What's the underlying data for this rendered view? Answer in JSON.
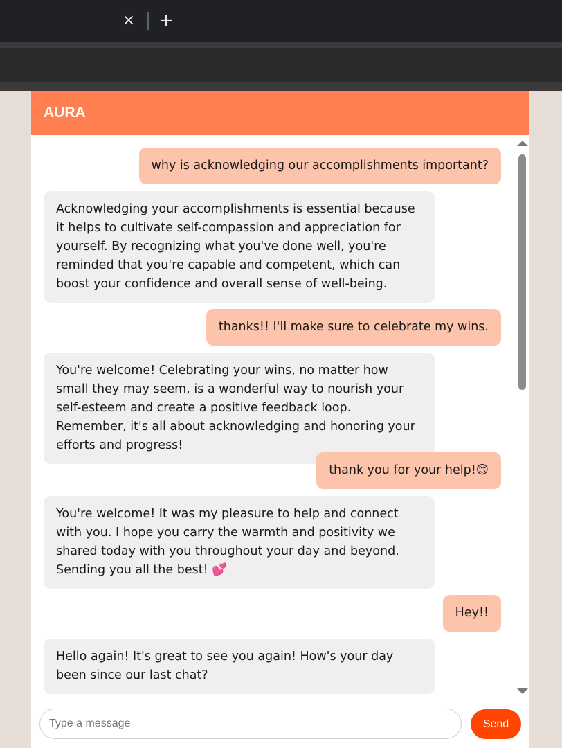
{
  "browser": {
    "tab_close_icon": "×",
    "new_tab_icon": "+"
  },
  "header": {
    "title": "AURA",
    "color": "#ff7f50"
  },
  "messages": [
    {
      "role": "user",
      "text": "why is acknowledging our accomplishments important?"
    },
    {
      "role": "bot",
      "text": "Acknowledging your accomplishments is essential because it helps to cultivate self-compassion and appreciation for yourself. By recognizing what you've done well, you're reminded that you're capable and competent, which can boost your confidence and overall sense of well-being."
    },
    {
      "role": "user",
      "text": "thanks!! I'll make sure to celebrate my wins."
    },
    {
      "role": "bot",
      "text": "You're welcome! Celebrating your wins, no matter how small they may seem, is a wonderful way to nourish your self-esteem and create a positive feedback loop. Remember, it's all about acknowledging and honoring your efforts and progress!"
    },
    {
      "role": "user",
      "text": "thank you for your help!😊"
    },
    {
      "role": "bot",
      "text": "You're welcome! It was my pleasure to help and connect with you. I hope you carry the warmth and positivity we shared today with you throughout your day and beyond. Sending you all the best! 💕"
    },
    {
      "role": "user",
      "text": "Hey!!"
    },
    {
      "role": "bot",
      "text": "Hello again! It's great to see you again! How's your day been since our last chat?"
    }
  ],
  "input": {
    "placeholder": "Type a message",
    "value": ""
  },
  "send_button": {
    "label": "Send",
    "color": "#ff4500"
  },
  "colors": {
    "user_bubble": "#fbc4ab",
    "bot_bubble": "#efefef",
    "page_background": "#e6ddd7"
  }
}
